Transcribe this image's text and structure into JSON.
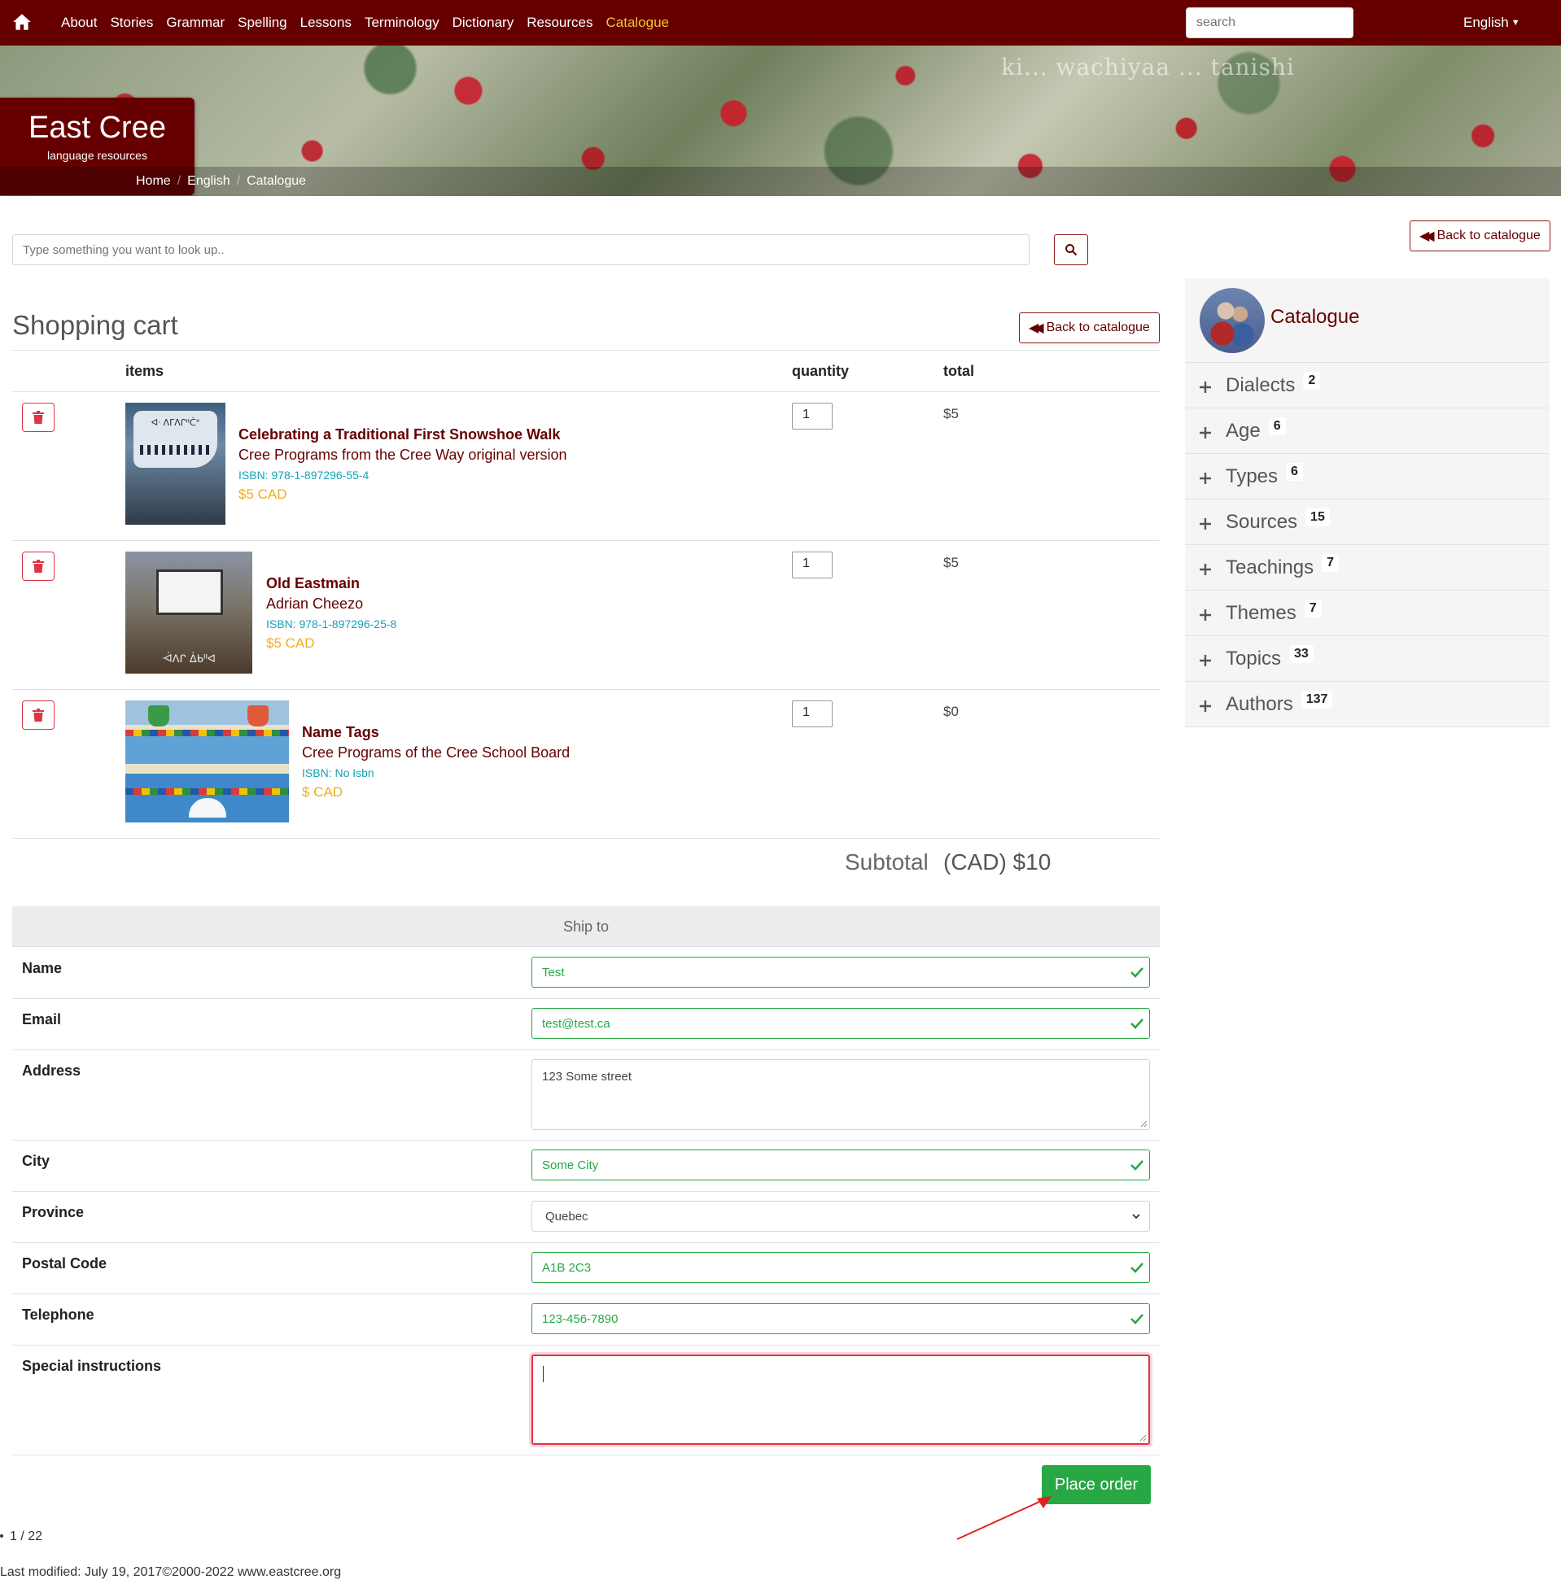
{
  "nav": {
    "home_icon": "home-icon",
    "links": [
      "About",
      "Stories",
      "Grammar",
      "Spelling",
      "Lessons",
      "Terminology",
      "Dictionary",
      "Resources",
      "Catalogue"
    ],
    "active_link": "Catalogue",
    "search_placeholder": "search",
    "language": "English"
  },
  "banner": {
    "logo_title": "East Cree",
    "logo_subtitle": "language resources",
    "overlay_text": "ki... wachiyaa ... tanishi",
    "breadcrumb": [
      "Home",
      "English",
      "Catalogue"
    ]
  },
  "lookup": {
    "placeholder": "Type something you want to look up..",
    "search_icon": "search-icon"
  },
  "back_to_catalogue": "Back to catalogue",
  "cart": {
    "title": "Shopping cart",
    "headers": {
      "items": "items",
      "quantity": "quantity",
      "total": "total"
    },
    "items": [
      {
        "title": "Celebrating a Traditional First Snowshoe Walk",
        "subtitle": "Cree Programs from the Cree Way original version",
        "isbn": "ISBN: 978-1-897296-55-4",
        "price": "$5 CAD",
        "quantity": "1",
        "total": "$5",
        "cover_text": "ᐊᐧ ᐱᒥᐱᒋᐦᑖᐤ"
      },
      {
        "title": "Old Eastmain",
        "subtitle": "Adrian Cheezo",
        "isbn": "ISBN: 978-1-897296-25-8",
        "price": "$5 CAD",
        "quantity": "1",
        "total": "$5",
        "cover_text": "ᐙᐱᒋ ᐄᑲᐦᐊ"
      },
      {
        "title": "Name Tags",
        "subtitle": "Cree Programs of the Cree School Board",
        "isbn": "ISBN: No Isbn",
        "price": "$ CAD",
        "quantity": "1",
        "total": "$0"
      }
    ],
    "subtotal_label": "Subtotal",
    "subtotal_value": "(CAD) $10"
  },
  "ship_to": {
    "heading": "Ship to",
    "fields": {
      "name": {
        "label": "Name",
        "value": "Test"
      },
      "email": {
        "label": "Email",
        "value": "test@test.ca"
      },
      "address": {
        "label": "Address",
        "value": "123 Some street"
      },
      "city": {
        "label": "City",
        "value": "Some City"
      },
      "province": {
        "label": "Province",
        "value": "Quebec"
      },
      "postal_code": {
        "label": "Postal Code",
        "value": "A1B 2C3"
      },
      "telephone": {
        "label": "Telephone",
        "value": "123-456-7890"
      },
      "special": {
        "label": "Special instructions",
        "value": ""
      }
    },
    "place_order": "Place order"
  },
  "pager": "1 / 22",
  "footer": "Last modified: July 19, 2017©2000-2022 www.eastcree.org",
  "sidebar": {
    "title": "Catalogue",
    "items": [
      {
        "label": "Dialects",
        "count": "2"
      },
      {
        "label": "Age",
        "count": "6"
      },
      {
        "label": "Types",
        "count": "6"
      },
      {
        "label": "Sources",
        "count": "15"
      },
      {
        "label": "Teachings",
        "count": "7"
      },
      {
        "label": "Themes",
        "count": "7"
      },
      {
        "label": "Topics",
        "count": "33"
      },
      {
        "label": "Authors",
        "count": "137"
      }
    ]
  },
  "colors": {
    "brand": "#660000",
    "accent_yellow": "#f4c430",
    "success": "#28a745",
    "danger": "#dc3545",
    "info": "#17a2b8"
  }
}
